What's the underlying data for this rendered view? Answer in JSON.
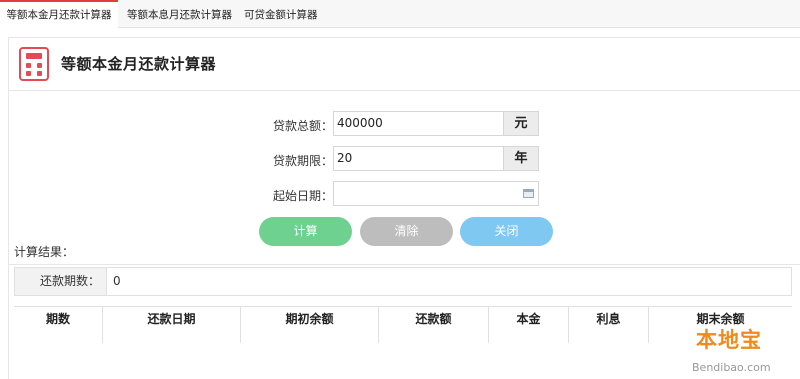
{
  "tabs": [
    {
      "label": "等额本金月还款计算器",
      "active": true
    },
    {
      "label": "等额本息月还款计算器",
      "active": false
    },
    {
      "label": "可贷金额计算器",
      "active": false
    }
  ],
  "header": {
    "title": "等额本金月还款计算器",
    "icon": "calculator-icon",
    "accent_color": "#e34a55"
  },
  "form": {
    "amount_label": "贷款总额：",
    "amount_value": "400000",
    "amount_unit": "元",
    "term_label": "贷款期限：",
    "term_value": "20",
    "term_unit": "年",
    "start_label": "起始日期：",
    "start_value": "",
    "date_icon": "calendar-icon"
  },
  "buttons": {
    "calc": "计算",
    "clear": "清除",
    "close": "关闭",
    "calc_color": "#6fd18f",
    "clear_color": "#bdbdbd",
    "close_color": "#7ec8f2"
  },
  "results": {
    "label": "计算结果：",
    "periods_label": "还款期数：",
    "periods_value": "0"
  },
  "table": {
    "columns": [
      "期数",
      "还款日期",
      "期初余额",
      "还款额",
      "本金",
      "利息",
      "期末余额"
    ]
  },
  "watermark": {
    "title": "本地宝",
    "url": "Bendibao.com"
  }
}
